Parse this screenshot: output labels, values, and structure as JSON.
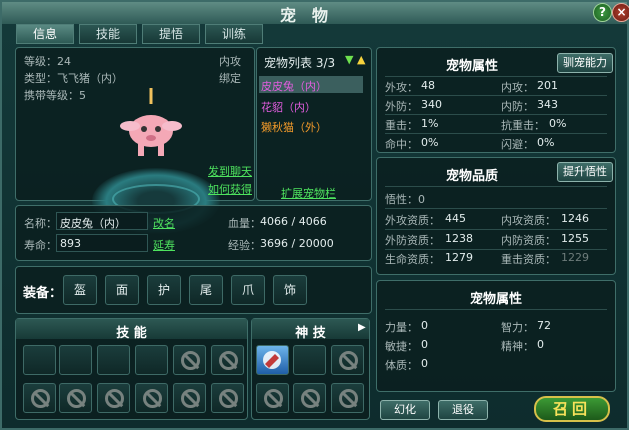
{
  "window": {
    "title": "宠物",
    "help_label": "?",
    "close_label": "×"
  },
  "tabs": [
    {
      "label": "信息"
    },
    {
      "label": "技能"
    },
    {
      "label": "提悟"
    },
    {
      "label": "训练"
    }
  ],
  "pet_view": {
    "level": "等级：24",
    "type": "类型：飞飞猪（内）",
    "carry_level": "携带等级：5",
    "attack_type": "内攻",
    "bound": "绑定",
    "chat_link": "发到聊天",
    "how_to_get": "如何获得"
  },
  "pet_list": {
    "header": "宠物列表 3/3",
    "items": [
      {
        "name": "皮皮兔（内）",
        "color": "#e35de0"
      },
      {
        "name": "花貂（内）",
        "color": "#e35de0"
      },
      {
        "name": "獭秋猫（外）",
        "color": "#f29a2a"
      }
    ],
    "expand_link": "扩展宠物栏"
  },
  "info": {
    "name_label": "名称：",
    "name_value": "皮皮兔（内）",
    "rename": "改名",
    "life_label": "寿命：",
    "life_value": "893",
    "extend": "延寿",
    "hp_label": "血量：",
    "hp_value": "4066 / 4066",
    "exp_label": "经验：",
    "exp_value": "3696 / 20000"
  },
  "equipment": {
    "label": "装备：",
    "slots": [
      "盔",
      "面",
      "护",
      "尾",
      "爪",
      "饰"
    ]
  },
  "skills": {
    "title": "技  能",
    "divine_title": "神  技",
    "arrow": "▶"
  },
  "attributes": {
    "title": "宠物属性",
    "button": "驯宠能力",
    "rows": [
      {
        "l1": "外攻：",
        "v1": "48",
        "l2": "内攻：",
        "v2": "201"
      },
      {
        "l1": "外防：",
        "v1": "340",
        "l2": "内防：",
        "v2": "343"
      },
      {
        "l1": "重击：",
        "v1": "1%",
        "l2": "抗重击：",
        "v2": "0%"
      },
      {
        "l1": "命中：",
        "v1": "0%",
        "l2": "闪避：",
        "v2": "0%"
      }
    ]
  },
  "quality": {
    "title": "宠物品质",
    "button": "提升悟性",
    "comprehension": "悟性：0",
    "rows": [
      {
        "l1": "外攻资质：",
        "v1": "445",
        "l2": "内攻资质：",
        "v2": "1246"
      },
      {
        "l1": "外防资质：",
        "v1": "1238",
        "l2": "内防资质：",
        "v2": "1255"
      },
      {
        "l1": "生命资质：",
        "v1": "1279",
        "l2": "重击资质：",
        "v2": "1229"
      }
    ]
  },
  "attributes2": {
    "title": "宠物属性",
    "rows": [
      {
        "l1": "力量：",
        "v1": "0",
        "l2": "智力：",
        "v2": "72"
      },
      {
        "l1": "敏捷：",
        "v1": "0",
        "l2": "精神：",
        "v2": "0"
      },
      {
        "l1": "体质：",
        "v1": "0",
        "l2": "",
        "v2": ""
      }
    ]
  },
  "actions": {
    "transform": "幻化",
    "retire": "退役",
    "summon": "召回"
  },
  "colors": {
    "accent": "#f7d33d",
    "link": "#4ee35e",
    "panel": "#0a1e1f"
  }
}
